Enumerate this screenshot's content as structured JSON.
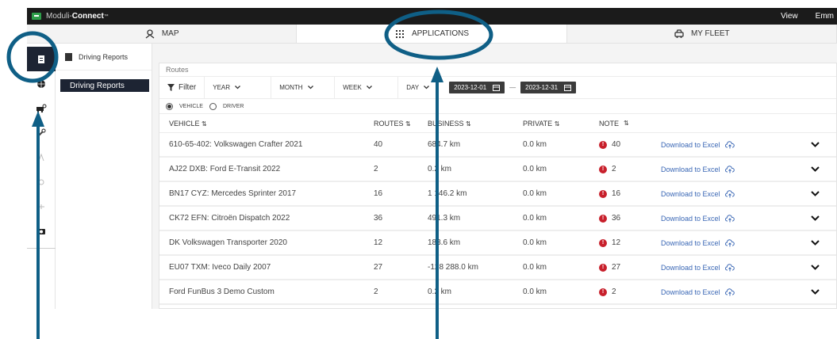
{
  "topbar": {
    "app_name_prefix": "Moduli-",
    "app_name_bold": "Connect",
    "app_name_tm": "™",
    "view_label": "View",
    "user_label": "Emm"
  },
  "nav": {
    "map": "MAP",
    "applications": "APPLICATIONS",
    "my_fleet": "MY FLEET"
  },
  "subnav": {
    "header": "Driving Reports",
    "item": "Driving Reports"
  },
  "card": {
    "title": "Routes"
  },
  "filters": {
    "filter_label": "Filter",
    "year": "YEAR",
    "month": "MONTH",
    "week": "WEEK",
    "day": "DAY",
    "date_from": "2023-12-01",
    "date_to": "2023-12-31",
    "separator": "—"
  },
  "mode": {
    "vehicle": "VEHICLE",
    "driver": "DRIVER"
  },
  "columns": {
    "vehicle": "VEHICLE",
    "routes": "ROUTES",
    "business": "BUSINESS",
    "private": "PRIVATE",
    "note": "NOTE",
    "sort_glyph": "⇅"
  },
  "rows": [
    {
      "vehicle": "610-65-402: Volkswagen Crafter 2021",
      "routes": "40",
      "business": "684.7 km",
      "private": "0.0 km",
      "note": "40",
      "download": "Download to Excel"
    },
    {
      "vehicle": "AJ22 DXB: Ford E-Transit 2022",
      "routes": "2",
      "business": "0.2 km",
      "private": "0.0 km",
      "note": "2",
      "download": "Download to Excel"
    },
    {
      "vehicle": "BN17 CYZ: Mercedes Sprinter 2017",
      "routes": "16",
      "business": "1 146.2 km",
      "private": "0.0 km",
      "note": "16",
      "download": "Download to Excel"
    },
    {
      "vehicle": "CK72 EFN: Citroën Dispatch 2022",
      "routes": "36",
      "business": "491.3 km",
      "private": "0.0 km",
      "note": "36",
      "download": "Download to Excel"
    },
    {
      "vehicle": "DK Volkswagen Transporter 2020",
      "routes": "12",
      "business": "183.6 km",
      "private": "0.0 km",
      "note": "12",
      "download": "Download to Excel"
    },
    {
      "vehicle": "EU07 TXM: Iveco Daily 2007",
      "routes": "27",
      "business": "-128 288.0 km",
      "private": "0.0 km",
      "note": "27",
      "download": "Download to Excel"
    },
    {
      "vehicle": "Ford FunBus 3 Demo Custom",
      "routes": "2",
      "business": "0.2 km",
      "private": "0.0 km",
      "note": "2",
      "download": "Download to Excel"
    }
  ],
  "colors": {
    "annotation": "#0f5f86",
    "dark_nav": "#1d2433",
    "alert": "#c8202c",
    "link": "#3a67b5"
  }
}
